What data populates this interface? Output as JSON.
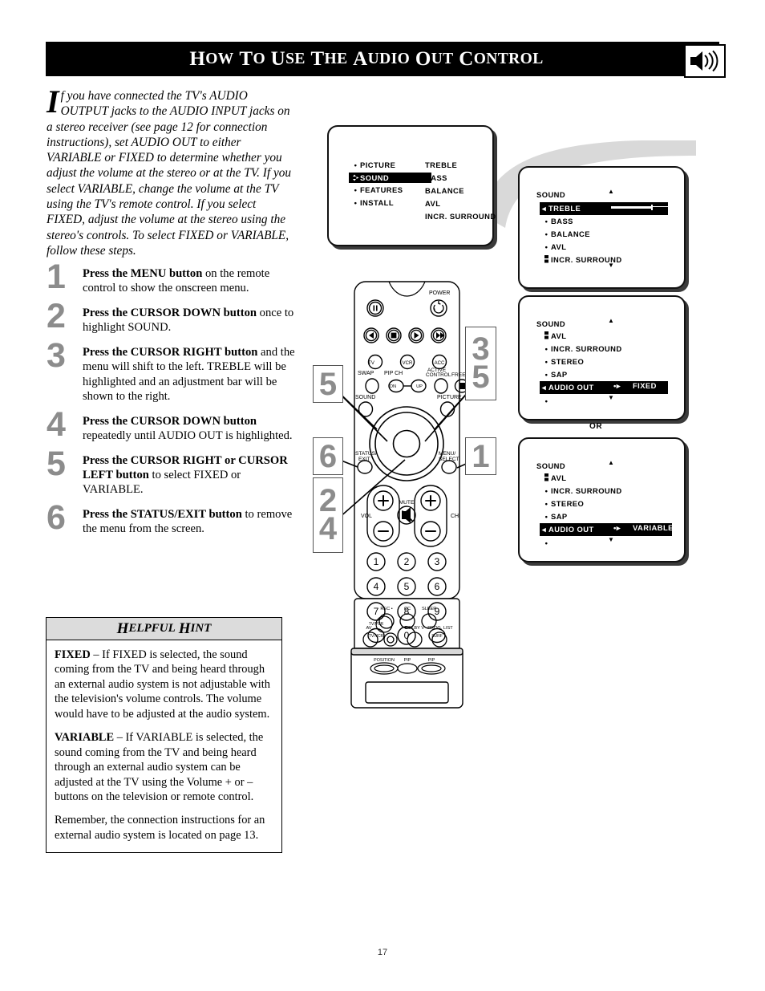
{
  "header": {
    "title_words": [
      {
        "cap": "H",
        "rest": "OW"
      },
      {
        "cap": "T",
        "rest": "O"
      },
      {
        "cap": "U",
        "rest": "SE"
      },
      {
        "cap": "T",
        "rest": "HE"
      },
      {
        "cap": "A",
        "rest": "UDIO"
      },
      {
        "cap": "O",
        "rest": "UT"
      },
      {
        "cap": "C",
        "rest": "ONTROL"
      }
    ],
    "title_plain": "How to Use the Audio Out Control",
    "icon": "speaker-volume-icon"
  },
  "intro": {
    "dropcap": "I",
    "text": "f you have connected the TV's AUDIO OUTPUT jacks to the AUDIO INPUT jacks on a stereo receiver (see page 12 for connection instructions), set AUDIO OUT to either VARIABLE or FIXED to determine whether you adjust the volume at the stereo or at the TV.  If you select VARIABLE, change the volume at the TV using the TV's remote control. If you select FIXED, adjust the volume at the stereo using the stereo's controls.  To select FIXED or VARIABLE, follow these steps."
  },
  "steps": [
    {
      "num": "1",
      "bold": "Press the MENU button",
      "rest": " on the remote control to show the onscreen menu."
    },
    {
      "num": "2",
      "bold": "Press the CURSOR DOWN button",
      "rest": " once to highlight SOUND."
    },
    {
      "num": "3",
      "bold": "Press the CURSOR RIGHT button",
      "rest": " and the menu will shift to the left. TREBLE will be highlighted and an adjustment bar will be shown to the right."
    },
    {
      "num": "4",
      "bold": "Press the CURSOR DOWN button",
      "rest": " repeatedly until AUDIO OUT is highlighted."
    },
    {
      "num": "5",
      "bold": "Press the CURSOR RIGHT or CURSOR LEFT button",
      "rest": " to select FIXED or VARIABLE."
    },
    {
      "num": "6",
      "bold": "Press the STATUS/EXIT button",
      "rest": " to remove the menu from the screen."
    }
  ],
  "hint": {
    "heading_cap1": "H",
    "heading_rest1": "ELPFUL",
    "heading_cap2": "H",
    "heading_rest2": "INT",
    "heading_plain": "Helpful Hint",
    "p1_bold": "FIXED",
    "p1": " – If FIXED is selected, the sound coming from the TV and being heard through an external audio system is not adjustable with the television's volume controls. The volume would have to be adjusted at the audio system.",
    "p2_bold": "VARIABLE",
    "p2": " – If VARIABLE is selected, the sound coming from the TV and being heard through an external audio system can be adjusted at the TV using the Volume + or – buttons on the television or remote control.",
    "p3": "Remember, the connection instructions for an external audio system is located on page 13."
  },
  "tv_screens": {
    "screen1": {
      "left_items": [
        {
          "label": "PICTURE",
          "marker": "dot",
          "highlight": false
        },
        {
          "label": "SOUND",
          "marker": "updown-right",
          "highlight": true
        },
        {
          "label": "FEATURES",
          "marker": "dot",
          "highlight": false
        },
        {
          "label": "INSTALL",
          "marker": "dot",
          "highlight": false
        }
      ],
      "right_items": [
        "TREBLE",
        "BASS",
        "BALANCE",
        "AVL",
        "INCR.  SURROUND"
      ]
    },
    "screen2": {
      "title": "SOUND",
      "scroll_up": "▲",
      "scroll_down": "▼",
      "items": [
        {
          "label": "TREBLE",
          "marker": "left-arrow",
          "highlight": true,
          "bar": true,
          "value": "30"
        },
        {
          "label": "BASS",
          "marker": "dot",
          "highlight": false
        },
        {
          "label": "BALANCE",
          "marker": "dot",
          "highlight": false
        },
        {
          "label": "AVL",
          "marker": "dot",
          "highlight": false
        },
        {
          "label": "INCR.  SURROUND",
          "marker": "scrollthumb",
          "highlight": false
        }
      ]
    },
    "screen3": {
      "title": "SOUND",
      "scroll_up": "▲",
      "scroll_down": "▼",
      "items": [
        {
          "label": "AVL",
          "marker": "scrollthumb",
          "highlight": false
        },
        {
          "label": "INCR.  SURROUND",
          "marker": "dot",
          "highlight": false
        },
        {
          "label": "STEREO",
          "marker": "dot",
          "highlight": false
        },
        {
          "label": "SAP",
          "marker": "dot",
          "highlight": false
        },
        {
          "label": "AUDIO  OUT",
          "marker": "left-arrow",
          "highlight": true,
          "value": "FIXED",
          "value_marker": "•▸"
        },
        {
          "label": "",
          "marker": "dot",
          "highlight": false
        }
      ]
    },
    "or_label": "OR",
    "screen4": {
      "title": "SOUND",
      "scroll_up": "▲",
      "scroll_down": "▼",
      "items": [
        {
          "label": "AVL",
          "marker": "scrollthumb",
          "highlight": false
        },
        {
          "label": "INCR.  SURROUND",
          "marker": "dot",
          "highlight": false
        },
        {
          "label": "STEREO",
          "marker": "dot",
          "highlight": false
        },
        {
          "label": "SAP",
          "marker": "dot",
          "highlight": false
        },
        {
          "label": "AUDIO  OUT",
          "marker": "left-arrow",
          "highlight": true,
          "value": "VARIABLE",
          "value_marker": "•▸"
        },
        {
          "label": "",
          "marker": "dot",
          "highlight": false
        }
      ]
    }
  },
  "remote": {
    "labels": {
      "power": "POWER",
      "swap": "SWAP",
      "pip_ch": "PIP CH",
      "down": "DN",
      "up": "UP",
      "active_control": "ACTIVE\nCONTROL",
      "freeze": "FREEZE",
      "sound": "SOUND",
      "picture": "PICTURE",
      "tv": "TV",
      "vcr": "VCR",
      "acc": "ACC",
      "status_exit": "STATUS/\nEXIT",
      "menu_select": "MENU/\nSELECT",
      "vol": "VOL",
      "ch": "CH",
      "mute": "MUTE",
      "tv_vcr": "TV/VCR",
      "surf": "SURF",
      "rec": "REC •",
      "cc": "CC",
      "sleep": "SLEEP",
      "av": "AV",
      "dolby_v": "DOLBY V",
      "prog_list": "PROG. LIST",
      "position": "POSITION",
      "pip": "PIP",
      "pip_swap": "PIP"
    },
    "keypad": [
      "1",
      "2",
      "3",
      "4",
      "5",
      "6",
      "7",
      "8",
      "9",
      "0"
    ],
    "callouts": [
      {
        "id": "callout-5-left",
        "text": [
          "5"
        ]
      },
      {
        "id": "callout-35-right",
        "text": [
          "3",
          "5"
        ]
      },
      {
        "id": "callout-6-left",
        "text": [
          "6"
        ]
      },
      {
        "id": "callout-1-right",
        "text": [
          "1"
        ]
      },
      {
        "id": "callout-24-left",
        "text": [
          "2",
          "4"
        ]
      }
    ]
  },
  "page_number": "17"
}
